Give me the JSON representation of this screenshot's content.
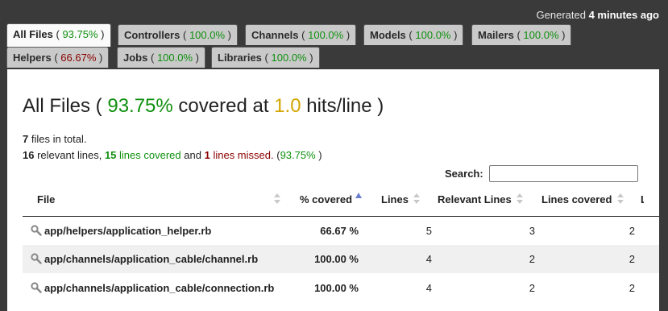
{
  "header": {
    "generated_prefix": "Generated",
    "generated_time": "4 minutes ago"
  },
  "tabs": [
    {
      "name": "All Files",
      "pct": "93.75%",
      "status": "green",
      "active": true
    },
    {
      "name": "Controllers",
      "pct": "100.0%",
      "status": "green"
    },
    {
      "name": "Channels",
      "pct": "100.0%",
      "status": "green"
    },
    {
      "name": "Models",
      "pct": "100.0%",
      "status": "green"
    },
    {
      "name": "Mailers",
      "pct": "100.0%",
      "status": "green"
    },
    {
      "name": "Helpers",
      "pct": "66.67%",
      "status": "red"
    },
    {
      "name": "Jobs",
      "pct": "100.0%",
      "status": "green"
    },
    {
      "name": "Libraries",
      "pct": "100.0%",
      "status": "green"
    }
  ],
  "title": {
    "prefix": "All Files (",
    "pct": "93.75%",
    "middle": "covered at",
    "hits": "1.0",
    "suffix": "hits/line )"
  },
  "summary": {
    "files_count": "7",
    "files_text": "files in total.",
    "relevant_count": "16",
    "relevant_text": "relevant lines,",
    "covered_count": "15",
    "covered_text": "lines covered",
    "and_text": "and",
    "missed_count": "1",
    "missed_text": "lines missed.",
    "pct_open": "(",
    "pct": "93.75%",
    "pct_close": ")"
  },
  "search": {
    "label": "Search:",
    "value": ""
  },
  "table": {
    "columns": [
      "File",
      "% covered",
      "Lines",
      "Relevant Lines",
      "Lines covered",
      "L"
    ],
    "rows": [
      {
        "file": "app/helpers/application_helper.rb",
        "pct": "66.67 %",
        "status": "red",
        "lines": "5",
        "relevant": "3",
        "covered": "2"
      },
      {
        "file": "app/channels/application_cable/channel.rb",
        "pct": "100.00 %",
        "status": "green",
        "lines": "4",
        "relevant": "2",
        "covered": "2"
      },
      {
        "file": "app/channels/application_cable/connection.rb",
        "pct": "100.00 %",
        "status": "green",
        "lines": "4",
        "relevant": "2",
        "covered": "2"
      }
    ]
  },
  "colors": {
    "covered_green": "#109010",
    "missed_red": "#8b0000",
    "hits_gold": "#d4a500",
    "background": "#3a3a3a"
  }
}
